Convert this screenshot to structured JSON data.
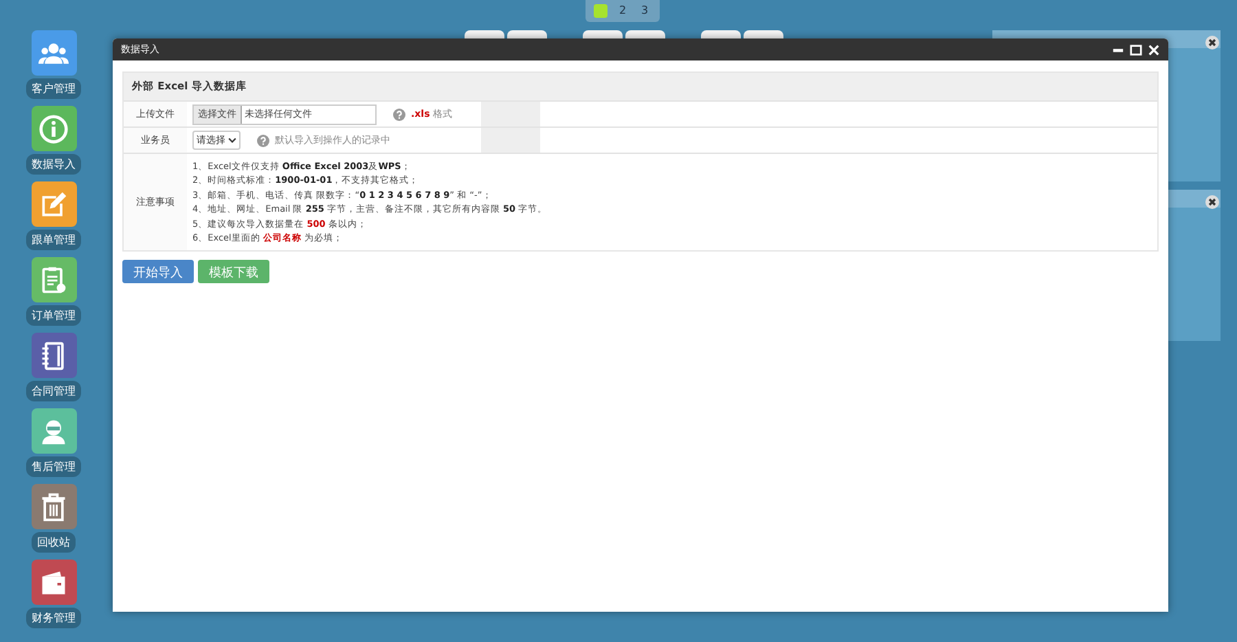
{
  "desktop_icons": [
    {
      "label": "客户管理",
      "kind": "users",
      "color": "#4a9be8"
    },
    {
      "label": "数据导入",
      "kind": "info",
      "color": "#5cb85c"
    },
    {
      "label": "跟单管理",
      "kind": "edit",
      "color": "#f0a030"
    },
    {
      "label": "订单管理",
      "kind": "clipboard",
      "color": "#66bb66"
    },
    {
      "label": "合同管理",
      "kind": "notebook",
      "color": "#5a5fa8"
    },
    {
      "label": "售后管理",
      "kind": "agent",
      "color": "#5cbf9c"
    },
    {
      "label": "回收站",
      "kind": "trash",
      "color": "#8a7a70"
    },
    {
      "label": "财务管理",
      "kind": "wallet",
      "color": "#c04a52"
    }
  ],
  "pages": [
    {
      "selected": true
    },
    {
      "label": "2",
      "selected": false
    },
    {
      "label": "3",
      "selected": false
    }
  ],
  "dialog": {
    "title": "数据导入",
    "heading": "外部 Excel 导入数据库",
    "upload": {
      "label": "上传文件",
      "button": "选择文件",
      "file_status": "未选择任何文件",
      "ext": ".xls",
      "ext_suffix": "格式"
    },
    "salesperson": {
      "label": "业务员",
      "select": "请选择",
      "hint": "默认导入到操作人的记录中"
    },
    "notes_label": "注意事项",
    "notes": [
      [
        {
          "text": "1、Excel文件仅支持 ",
          "kind": "plain"
        },
        {
          "text": "Office Excel 2003",
          "kind": "bold"
        },
        {
          "text": "及",
          "kind": "plain"
        },
        {
          "text": "WPS",
          "kind": "bold"
        },
        {
          "text": "；",
          "kind": "plain"
        }
      ],
      [
        {
          "text": "2、时间格式标准：",
          "kind": "plain"
        },
        {
          "text": "1900-01-01",
          "kind": "bold"
        },
        {
          "text": "，不支持其它格式；",
          "kind": "plain"
        }
      ],
      [
        {
          "text": "3、邮箱、手机、电话、传真 限数字：“",
          "kind": "plain"
        },
        {
          "text": "0 1 2 3 4 5 6 7 8 9",
          "kind": "bold"
        },
        {
          "text": "” 和 “-”；",
          "kind": "plain"
        }
      ],
      [
        {
          "text": "4、地址、网址、Email 限 ",
          "kind": "plain"
        },
        {
          "text": "255",
          "kind": "bold"
        },
        {
          "text": " 字节，主营、备注不限，其它所有内容限 ",
          "kind": "plain"
        },
        {
          "text": "50",
          "kind": "bold"
        },
        {
          "text": " 字节。",
          "kind": "plain"
        }
      ],
      [
        {
          "text": "5、建议每次导入数据量在 ",
          "kind": "plain"
        },
        {
          "text": "500",
          "kind": "red"
        },
        {
          "text": " 条以内；",
          "kind": "plain"
        }
      ],
      [
        {
          "text": "6、Excel里面的 ",
          "kind": "plain"
        },
        {
          "text": "公司名称",
          "kind": "red"
        },
        {
          "text": " 为必填；",
          "kind": "plain"
        }
      ]
    ],
    "buttons": [
      {
        "label": "开始导入",
        "kind": "primary"
      },
      {
        "label": "模板下载",
        "kind": "success"
      }
    ]
  }
}
